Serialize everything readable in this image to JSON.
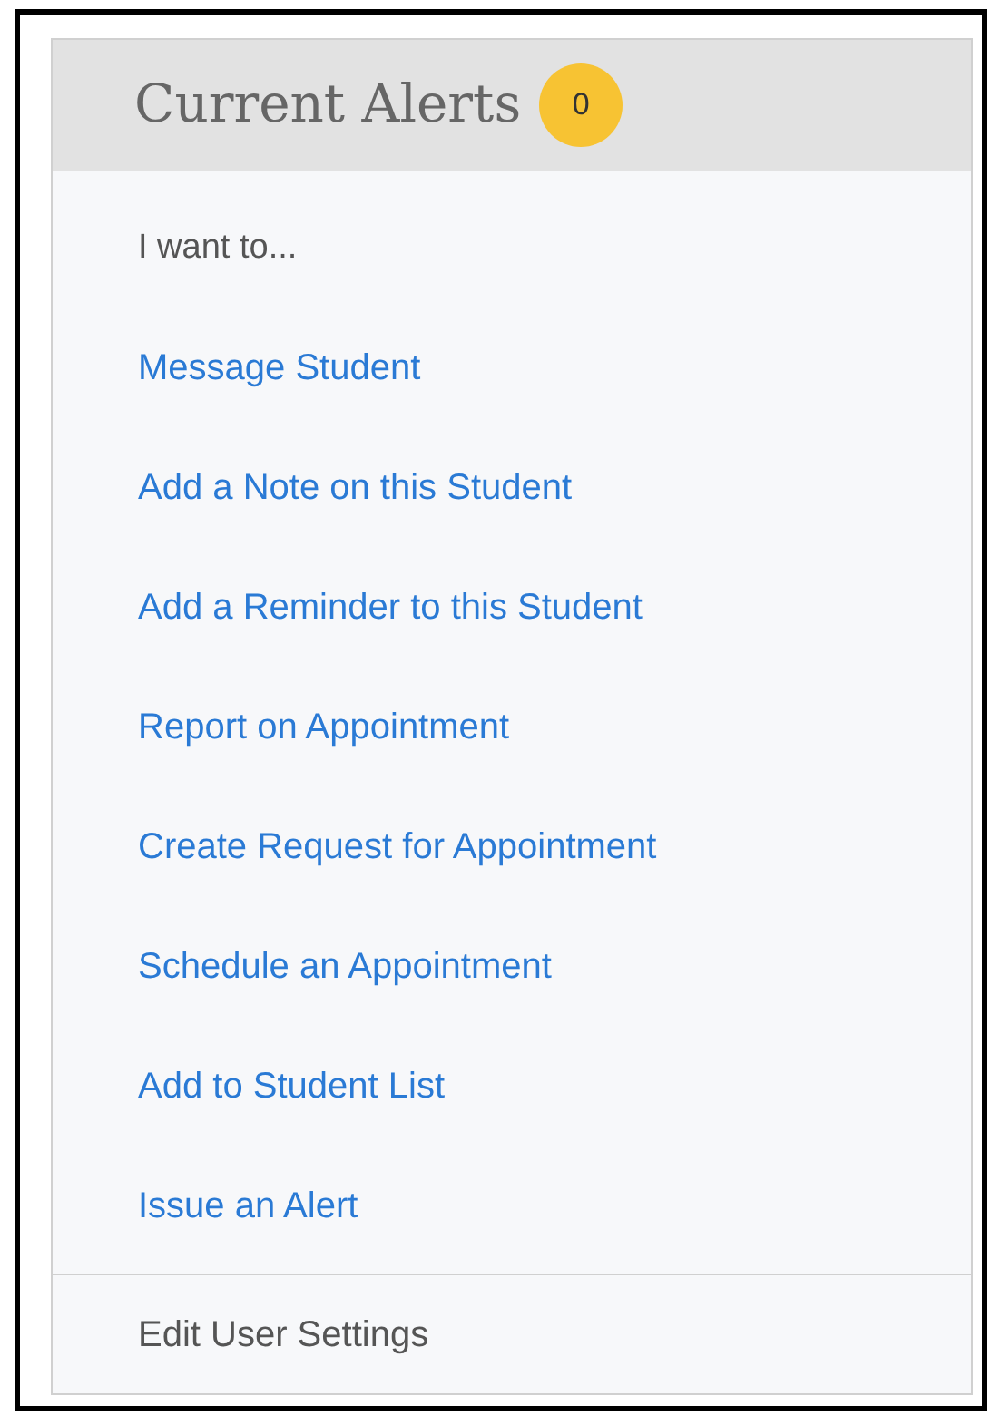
{
  "header": {
    "title": "Current Alerts",
    "badge": "0"
  },
  "intro": "I want to...",
  "actions": [
    {
      "label": "Message Student"
    },
    {
      "label": "Add a Note on this Student"
    },
    {
      "label": "Add a Reminder to this Student"
    },
    {
      "label": "Report on Appointment"
    },
    {
      "label": "Create Request for Appointment"
    },
    {
      "label": "Schedule an Appointment"
    },
    {
      "label": "Add to Student List"
    },
    {
      "label": "Issue an Alert"
    }
  ],
  "footer_link": "Edit User Settings"
}
